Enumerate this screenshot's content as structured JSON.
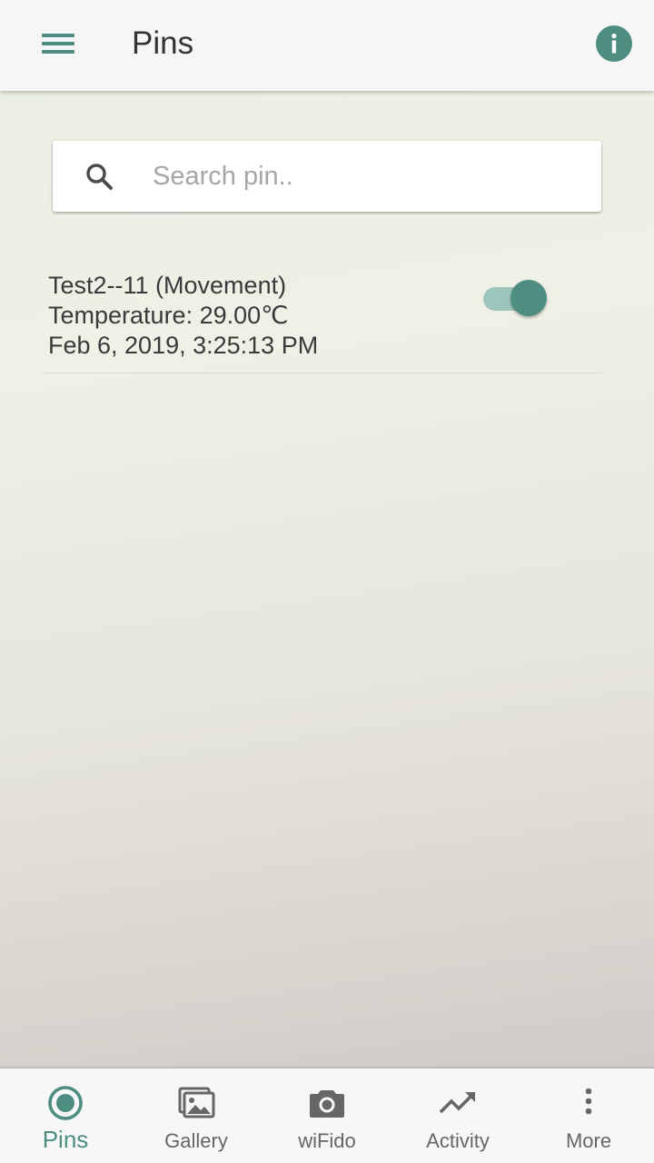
{
  "header": {
    "title": "Pins",
    "menu_icon": "menu-icon",
    "info_icon": "info-icon"
  },
  "search": {
    "placeholder": "Search pin..",
    "value": "",
    "icon": "search-icon"
  },
  "pins": [
    {
      "name": "Test2--11 (Movement)",
      "reading": "Temperature: 29.00℃",
      "timestamp": "Feb 6, 2019, 3:25:13 PM",
      "enabled": true
    }
  ],
  "bottom_nav": {
    "items": [
      {
        "label": "Pins",
        "icon": "radio-button-icon",
        "active": true
      },
      {
        "label": "Gallery",
        "icon": "gallery-icon",
        "active": false
      },
      {
        "label": "wiFido",
        "icon": "camera-icon",
        "active": false
      },
      {
        "label": "Activity",
        "icon": "trending-up-icon",
        "active": false
      },
      {
        "label": "More",
        "icon": "more-vertical-icon",
        "active": false
      }
    ]
  },
  "colors": {
    "accent": "#4e8e80",
    "accent_light": "#9ec5bc",
    "inactive": "#666666"
  }
}
